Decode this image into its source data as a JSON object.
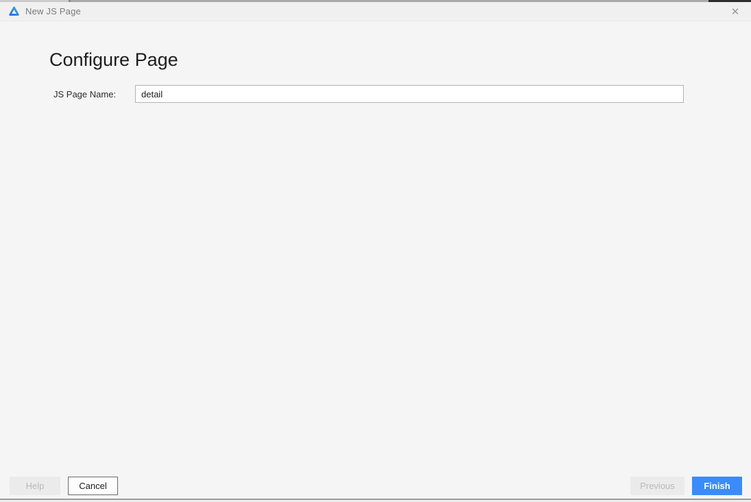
{
  "titlebar": {
    "title": "New JS Page",
    "close_glyph": "✕",
    "logo_icon": "deveco-logo-icon"
  },
  "page": {
    "heading": "Configure Page"
  },
  "form": {
    "label": "JS Page Name:",
    "value": "detail"
  },
  "buttons": {
    "help": "Help",
    "cancel": "Cancel",
    "previous": "Previous",
    "finish": "Finish"
  },
  "colors": {
    "accent_blue": "#3b8cfa",
    "dialog_bg": "#f5f5f5",
    "titlebar_bg": "#f0f0f0",
    "disabled_bg": "#ebebeb",
    "disabled_text": "#b8b8b8",
    "input_border": "#b2b2b2",
    "cancel_border": "#6b6b6b"
  }
}
